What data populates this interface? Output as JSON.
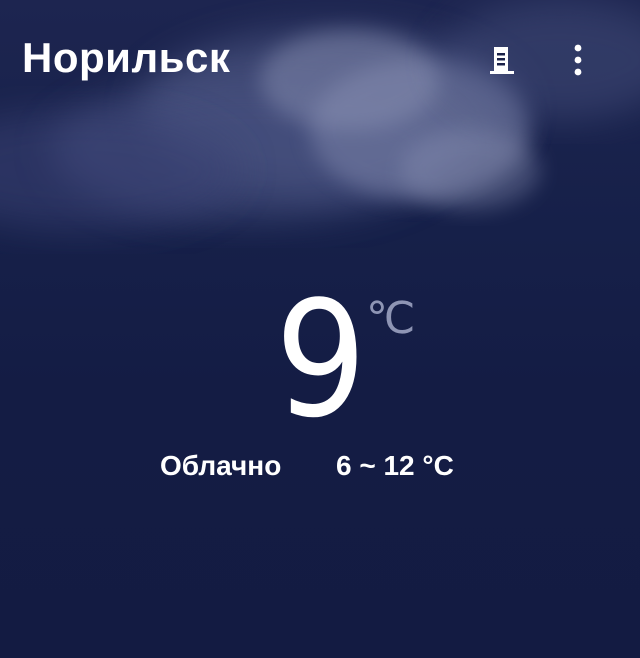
{
  "header": {
    "city": "Норильск",
    "city_list_icon": "building-icon",
    "menu_icon": "more-vertical-icon"
  },
  "weather": {
    "temperature": "9",
    "unit": "℃",
    "condition": "Облачно",
    "range": "6 ~ 12 °C"
  },
  "colors": {
    "background": "#141c44",
    "text": "#ffffff",
    "unit": "#8e95b4"
  }
}
